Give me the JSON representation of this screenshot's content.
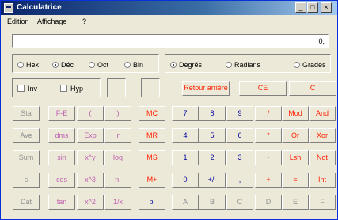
{
  "window": {
    "title": "Calculatrice"
  },
  "titlebar_buttons": {
    "minimize": "_",
    "maximize": "□",
    "close": "×"
  },
  "menu": {
    "edit": "Edition",
    "view": "Affichage",
    "help": "?"
  },
  "display": {
    "value": "0,"
  },
  "number_base": {
    "hex": "Hex",
    "dec": "Déc",
    "oct": "Oct",
    "bin": "Bin",
    "selected": "Déc"
  },
  "angle_unit": {
    "degrees": "Degrés",
    "radians": "Radians",
    "grads": "Grades",
    "selected": "Degrés"
  },
  "checks": {
    "inv": "Inv",
    "hyp": "Hyp"
  },
  "controls": {
    "backspace": "Retour arrière",
    "ce": "CE",
    "c": "C"
  },
  "stat_keys": [
    "Sta",
    "Ave",
    "Sum",
    "s",
    "Dat"
  ],
  "fn_col1": [
    "F-E",
    "dms",
    "sin",
    "cos",
    "tan"
  ],
  "fn_col2": [
    "(",
    "Exp",
    "x^y",
    "x^3",
    "x^2"
  ],
  "fn_col3": [
    ")",
    "ln",
    "log",
    "n!",
    "1/x"
  ],
  "memory_keys": [
    "MC",
    "MR",
    "MS",
    "M+",
    "pi"
  ],
  "digit_rows": [
    [
      "7",
      "8",
      "9",
      "/",
      "Mod",
      "And"
    ],
    [
      "4",
      "5",
      "6",
      "*",
      "Or",
      "Xor"
    ],
    [
      "1",
      "2",
      "3",
      "-",
      "Lsh",
      "Not"
    ],
    [
      "0",
      "+/-",
      ",",
      "+",
      "=",
      "Int"
    ],
    [
      "A",
      "B",
      "C",
      "D",
      "E",
      "F"
    ]
  ],
  "colors": {
    "digit": "#0000a0",
    "operator": "#ff2000",
    "function": "#c060b0",
    "disabled": "#909090",
    "background": "#ece9d8"
  }
}
